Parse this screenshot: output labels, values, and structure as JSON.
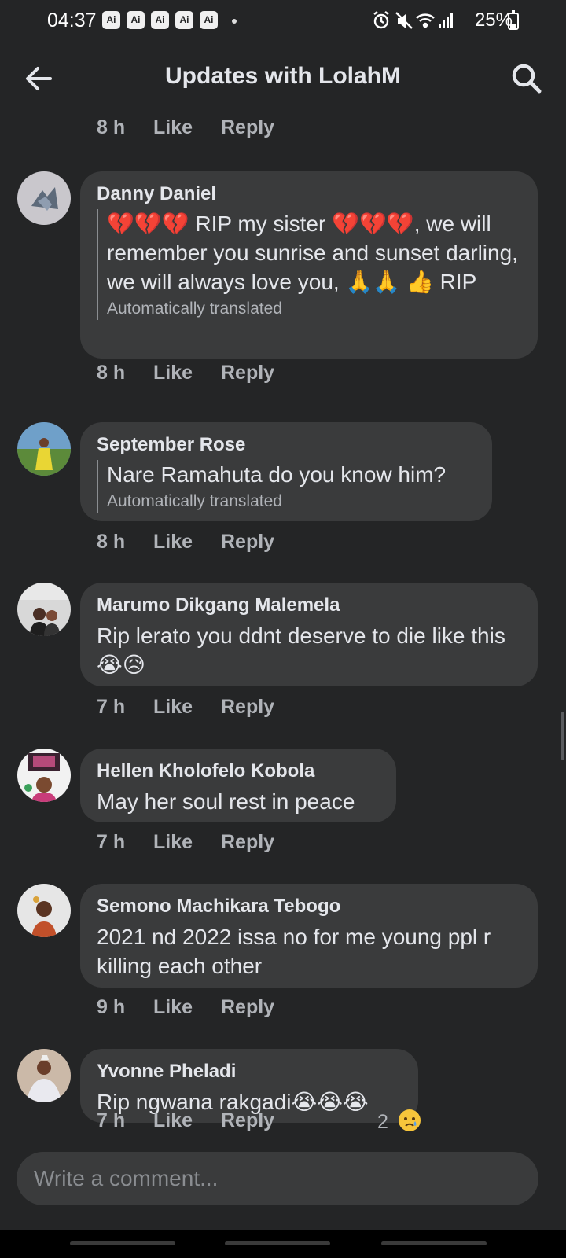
{
  "status_bar": {
    "time": "04:37",
    "ai_badges": [
      "Ai",
      "Ai",
      "Ai",
      "Ai",
      "Ai"
    ],
    "battery": "25%",
    "icons": [
      "alarm-icon",
      "mute-icon",
      "wifi-icon",
      "signal-icon",
      "battery-icon"
    ]
  },
  "header": {
    "title": "Updates with LolahM",
    "back_icon": "back-arrow-icon",
    "search_icon": "search-icon"
  },
  "actions": {
    "like": "Like",
    "reply": "Reply"
  },
  "top_action_row": {
    "time": "8 h"
  },
  "comments": [
    {
      "author": "Danny Daniel",
      "text": "💔💔💔 RIP my sister 💔💔💔, we will remember you sunrise and sunset darling, we will always love you, 🙏🙏 👍 RIP",
      "translated_note": "Automatically translated",
      "time": "8 h"
    },
    {
      "author": "September Rose",
      "text": "Nare Ramahuta do you know him?",
      "translated_note": "Automatically translated",
      "time": "8 h"
    },
    {
      "author": "Marumo Dikgang Malemela",
      "text": "Rip lerato you ddnt deserve to die like this😭😥",
      "time": "7 h"
    },
    {
      "author": "Hellen Kholofelo Kobola",
      "text": "May her soul rest in peace",
      "time": "7 h"
    },
    {
      "author": "Semono Machikara Tebogo",
      "text": "2021 nd 2022 issa no for me young ppl r killing each other",
      "time": "9 h"
    },
    {
      "author": "Yvonne Pheladi",
      "text": "Rip ngwana rakgadi😭😭😭",
      "time": "7 h",
      "reaction_count": "2",
      "reaction_icon": "sad-reaction-icon"
    }
  ],
  "composer": {
    "placeholder": "Write a comment..."
  },
  "colors": {
    "background": "#242526",
    "bubble": "#3a3b3c",
    "text_primary": "#e4e6eb",
    "text_secondary": "#b0b3b8"
  }
}
